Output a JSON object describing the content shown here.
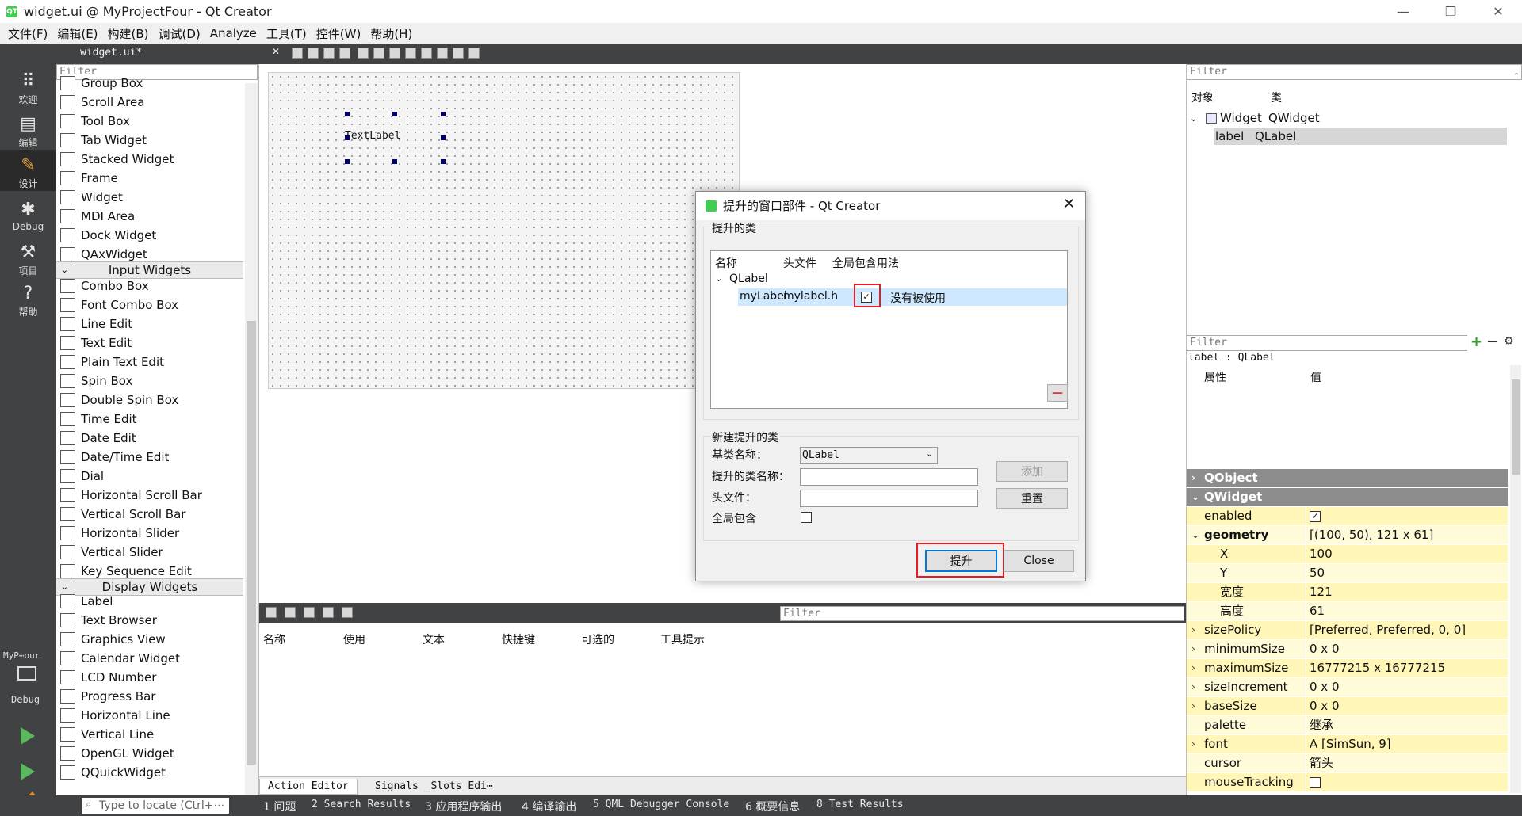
{
  "window": {
    "title": "widget.ui @ MyProjectFour - Qt Creator",
    "logo": "QT",
    "min": "—",
    "max": "❐",
    "close": "✕"
  },
  "menu": [
    "文件(F)",
    "编辑(E)",
    "构建(B)",
    "调试(D)",
    "Analyze",
    "工具(T)",
    "控件(W)",
    "帮助(H)"
  ],
  "modes": [
    {
      "label": "欢迎",
      "icon": "grid-icon",
      "glyph": "⠿"
    },
    {
      "label": "编辑",
      "icon": "edit-icon",
      "glyph": "▤"
    },
    {
      "label": "设计",
      "icon": "pencil-icon",
      "glyph": "✎"
    },
    {
      "label": "Debug",
      "icon": "bug-icon",
      "glyph": "✱"
    },
    {
      "label": "项目",
      "icon": "wrench-icon",
      "glyph": "⚒"
    },
    {
      "label": "帮助",
      "icon": "help-icon",
      "glyph": "?"
    }
  ],
  "kit": {
    "project": "MyP⋯our",
    "mode": "Debug"
  },
  "editor": {
    "file_tab": "widget.ui*"
  },
  "widget_box": {
    "filter_placeholder": "Filter",
    "items_containers": [
      "Group Box",
      "Scroll Area",
      "Tool Box",
      "Tab Widget",
      "Stacked Widget",
      "Frame",
      "Widget",
      "MDI Area",
      "Dock Widget",
      "QAxWidget"
    ],
    "cat_input": "Input Widgets",
    "items_input": [
      "Combo Box",
      "Font Combo Box",
      "Line Edit",
      "Text Edit",
      "Plain Text Edit",
      "Spin Box",
      "Double Spin Box",
      "Time Edit",
      "Date Edit",
      "Date/Time Edit",
      "Dial",
      "Horizontal Scroll Bar",
      "Vertical Scroll Bar",
      "Horizontal Slider",
      "Vertical Slider",
      "Key Sequence Edit"
    ],
    "cat_display": "Display Widgets",
    "items_display": [
      "Label",
      "Text Browser",
      "Graphics View",
      "Calendar Widget",
      "LCD Number",
      "Progress Bar",
      "Horizontal Line",
      "Vertical Line",
      "OpenGL Widget",
      "QQuickWidget"
    ]
  },
  "form": {
    "label_text": "TextLabel"
  },
  "action_editor": {
    "filter_placeholder": "Filter",
    "headers": [
      "名称",
      "使用",
      "文本",
      "快捷键",
      "可选的",
      "工具提示"
    ],
    "tabs": [
      "Action Editor",
      "Signals _Slots Edi⋯"
    ]
  },
  "object_inspector": {
    "filter_placeholder": "Filter",
    "headers": [
      "对象",
      "类"
    ],
    "rows": [
      {
        "object": "Widget",
        "class": "QWidget"
      },
      {
        "object": "label",
        "class": "QLabel"
      }
    ]
  },
  "property_editor": {
    "filter_placeholder": "Filter",
    "context": "label : QLabel",
    "headers": [
      "属性",
      "值"
    ],
    "groups": [
      "QObject",
      "QWidget"
    ],
    "rows": [
      {
        "name": "enabled",
        "value": "✓"
      },
      {
        "name": "geometry",
        "value": "[(100, 50), 121 x 61]"
      },
      {
        "name": "X",
        "value": "100"
      },
      {
        "name": "Y",
        "value": "50"
      },
      {
        "name": "宽度",
        "value": "121"
      },
      {
        "name": "高度",
        "value": "61"
      },
      {
        "name": "sizePolicy",
        "value": "[Preferred, Preferred, 0, 0]"
      },
      {
        "name": "minimumSize",
        "value": "0 x 0"
      },
      {
        "name": "maximumSize",
        "value": "16777215 x 16777215"
      },
      {
        "name": "sizeIncrement",
        "value": "0 x 0"
      },
      {
        "name": "baseSize",
        "value": "0 x 0"
      },
      {
        "name": "palette",
        "value": "继承"
      },
      {
        "name": "font",
        "value": "A  [SimSun, 9]"
      },
      {
        "name": "cursor",
        "value": "箭头"
      },
      {
        "name": "mouseTracking",
        "value": ""
      }
    ]
  },
  "dialog": {
    "title": "提升的窗口部件 - Qt Creator",
    "promoted_group": "提升的类",
    "table_headers": [
      "名称",
      "头文件",
      "全局包含",
      "用法"
    ],
    "base_class": "QLabel",
    "row": {
      "name": "myLabel",
      "header": "mylabel.h",
      "global": "✓",
      "usage": "没有被使用"
    },
    "new_group": "新建提升的类",
    "base_class_label": "基类名称：",
    "base_class_value": "QLabel",
    "promoted_name_label": "提升的类名称：",
    "header_file_label": "头文件：",
    "global_include_label": "全局包含",
    "add_button": "添加",
    "reset_button": "重置",
    "promote_button": "提升",
    "close_button": "Close",
    "remove_button": "—"
  },
  "statusbar": {
    "locate_placeholder": "Type to locate (Ctrl+⋯",
    "items": [
      "1 问题",
      "2 Search Results",
      "3 应用程序输出",
      "4 编译输出",
      "5 QML Debugger Console",
      "6 概要信息",
      "8 Test Results"
    ]
  },
  "colors": {
    "highlight": "#cde8ff",
    "prop_yellow": "#fff6b8",
    "prop_group": "#8c8c8c",
    "red_annotation": "#e81b23",
    "sidebar": "#404244"
  }
}
